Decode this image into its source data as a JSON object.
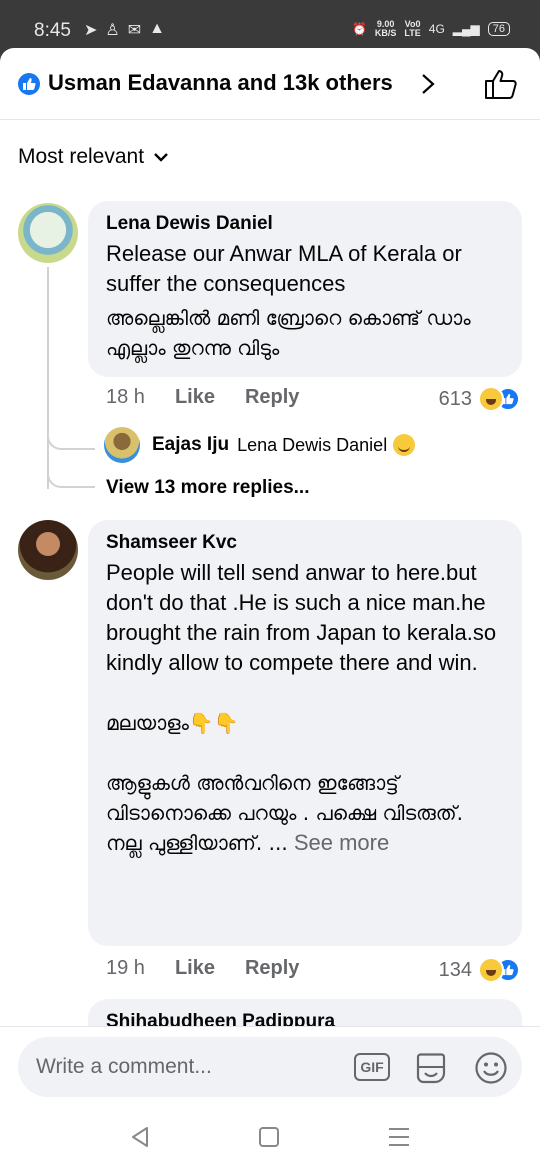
{
  "status_bar": {
    "time": "8:45",
    "left_icons": [
      "telegram-icon",
      "person-icon",
      "gmail-icon",
      "drive-icon"
    ],
    "speed_value": "9.00",
    "speed_unit": "KB/S",
    "volte_top": "Vo0",
    "volte_bottom": "LTE",
    "network": "4G",
    "battery": "76"
  },
  "header": {
    "title": "Usman Edavanna and 13k others",
    "accent": "#1877f2"
  },
  "sort": {
    "label": "Most relevant"
  },
  "comments": [
    {
      "author": "Lena Dewis Daniel",
      "text_en": "Release our  Anwar MLA of Kerala or suffer the consequences",
      "text_ml": "അല്ലെങ്കിൽ മണി ബ്രോറെ കൊണ്ട് ഡാം എല്ലാം തുറന്നു വിടും",
      "time": "18 h",
      "like_label": "Like",
      "reply_label": "Reply",
      "reaction_count": "613",
      "reply": {
        "author": "Eajas Iju",
        "text": "Lena Dewis Daniel"
      },
      "view_more": "View 13 more replies..."
    },
    {
      "author": "Shamseer Kvc",
      "text_en": "People will tell send anwar to here.but don't do that .He is such a nice man.he brought the rain from Japan to kerala.so kindly allow to compete there and win.",
      "text_ml_heading": "മലയാളം👇👇",
      "text_ml": "ആളുകൾ അൻവറിനെ ഇങ്ങോട്ട് വിടാനൊക്കെ പറയും . പക്ഷെ വിടരുത്.  നല്ല പുള്ളിയാണ്. ...",
      "see_more": "See more",
      "time": "19 h",
      "like_label": "Like",
      "reply_label": "Reply",
      "reaction_count": "134"
    },
    {
      "author": "Shihabudheen Padippura"
    }
  ],
  "composer": {
    "placeholder": "Write a comment...",
    "gif_label": "GIF"
  }
}
